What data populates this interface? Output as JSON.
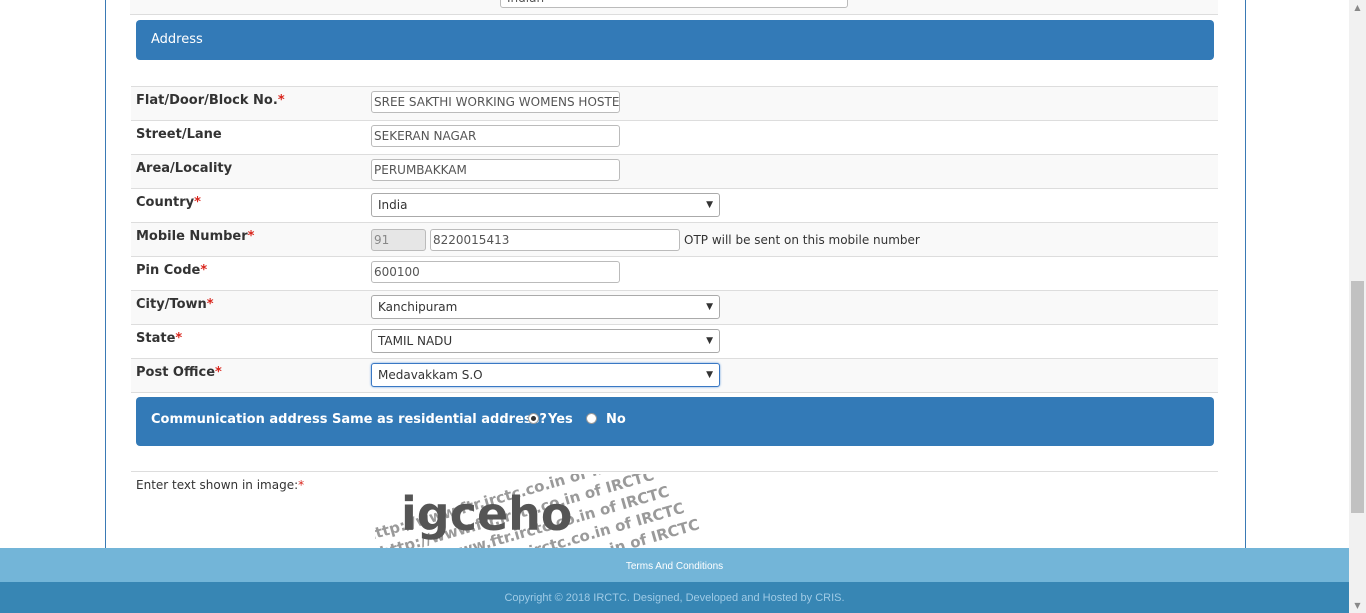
{
  "previous_field": {
    "value": "Indian"
  },
  "address_section": {
    "title": "Address"
  },
  "fields": {
    "flat": {
      "label": "Flat/Door/Block No.",
      "required": "*",
      "value": "SREE SAKTHI WORKING WOMENS HOSTEL"
    },
    "street": {
      "label": "Street/Lane",
      "value": "SEKERAN NAGAR"
    },
    "area": {
      "label": "Area/Locality",
      "value": "PERUMBAKKAM"
    },
    "country": {
      "label": "Country",
      "required": "*",
      "value": "India"
    },
    "mobile": {
      "label": "Mobile Number",
      "required": "*",
      "country_code": "91",
      "value": "8220015413",
      "note": "OTP will be sent on this mobile number"
    },
    "pincode": {
      "label": "Pin Code",
      "required": "*",
      "value": "600100"
    },
    "city": {
      "label": "City/Town",
      "required": "*",
      "value": "Kanchipuram"
    },
    "state": {
      "label": "State",
      "required": "*",
      "value": "TAMIL NADU"
    },
    "post_office": {
      "label": "Post Office",
      "required": "*",
      "value": "Medavakkam S.O"
    }
  },
  "communication": {
    "question": "Communication address Same as residential address?",
    "yes_label": "Yes",
    "no_label": "No",
    "selected": "Yes"
  },
  "captcha": {
    "label": "Enter text shown in image:",
    "required": "*",
    "text": "igceho",
    "watermark": "http://www.ftr.irctc.co.in of IRCTC"
  },
  "footer": {
    "terms_label": "Terms And Conditions",
    "copyright": "Copyright © 2018 IRCTC. Designed, Developed and Hosted by CRIS."
  },
  "icons": {
    "dropdown": "chevron-down-icon"
  },
  "colors": {
    "header_blue": "#337ab7",
    "required_red": "#d9251c",
    "footer_light": "#73b5d8",
    "footer_dark": "#3786b4"
  }
}
